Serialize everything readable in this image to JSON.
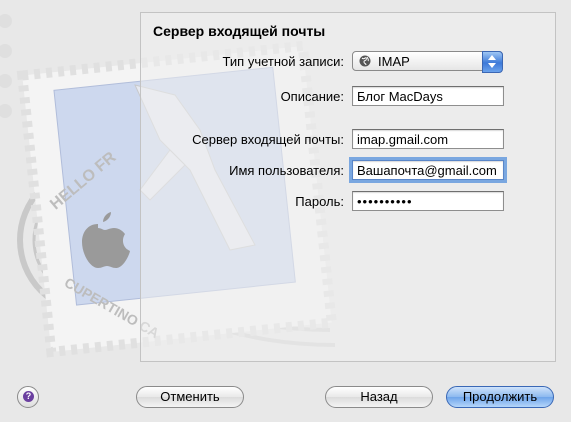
{
  "panel": {
    "title": "Сервер входящей почты"
  },
  "form": {
    "account_type_label": "Тип учетной записи:",
    "account_type_value": "IMAP",
    "description_label": "Описание:",
    "description_value": "Блог MacDays",
    "server_label": "Сервер входящей почты:",
    "server_value": "imap.gmail.com",
    "username_label": "Имя пользователя:",
    "username_value": "Вашапочта@gmail.com",
    "password_label": "Пароль:",
    "password_value": "••••••••••"
  },
  "buttons": {
    "cancel": "Отменить",
    "back": "Назад",
    "continue": "Продолжить",
    "help": "?"
  },
  "stamp": {
    "text_top": "HELLO FR",
    "text_bottom": "CUPERTINO CA"
  },
  "icons": {
    "account_type": "globe-icon",
    "dropdown": "stepper-arrows-icon",
    "help": "help-icon"
  },
  "colors": {
    "accent": "#3d79d8",
    "focus_ring": "#7aa7e0",
    "help_purple": "#6b3fa0"
  }
}
